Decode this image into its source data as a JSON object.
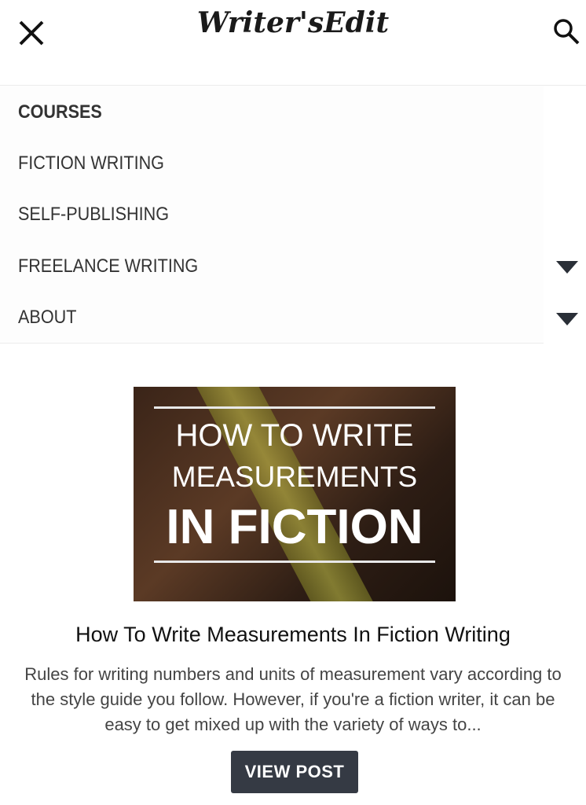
{
  "header": {
    "logo_text": "Writer'sEdit",
    "close_icon": "close-icon",
    "search_icon": "search-icon"
  },
  "menu": {
    "items": [
      {
        "label": "COURSES",
        "has_submenu": false
      },
      {
        "label": "FICTION WRITING",
        "has_submenu": false
      },
      {
        "label": "SELF-PUBLISHING",
        "has_submenu": false
      },
      {
        "label": "FREELANCE WRITING",
        "has_submenu": true
      },
      {
        "label": "ABOUT",
        "has_submenu": true
      }
    ]
  },
  "post": {
    "image_lines": [
      "HOW TO WRITE",
      "MEASUREMENTS",
      "IN FICTION"
    ],
    "title": "How To Write Measurements In Fiction Writing",
    "excerpt": "Rules for writing numbers and units of measurement vary according to the style guide you follow. However, if you're a fiction writer, it can be easy to get mixed up with the variety of ways to...",
    "button_label": "VIEW POST"
  }
}
